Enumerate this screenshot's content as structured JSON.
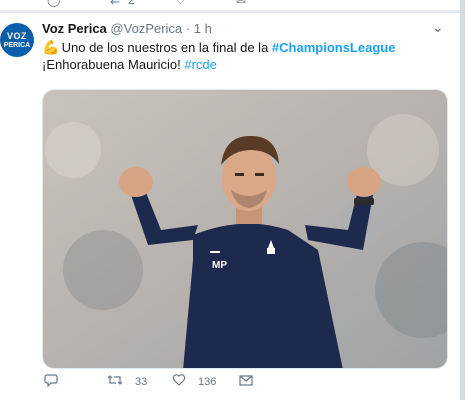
{
  "prev_tweet": {
    "retweet_count": "2"
  },
  "tweet": {
    "avatar_line1": "VOZ",
    "avatar_line2": "PERICA",
    "display_name": "Voz Perica",
    "handle": "@VozPerica",
    "separator": "·",
    "time": "1 h",
    "emoji": "💪",
    "text_part1": " Uno de los nuestros en la final de la ",
    "hashtag1": "#ChampionsLeague",
    "text_part2": " ¡Enhorabuena Mauricio! ",
    "hashtag2": "#rcde",
    "image_initials": "MP",
    "actions": {
      "reply_icon": "reply-icon",
      "retweet_icon": "retweet-icon",
      "retweet_count": "33",
      "like_icon": "heart-icon",
      "like_count": "136",
      "dm_icon": "envelope-icon"
    }
  },
  "colors": {
    "link": "#1da1f2",
    "text": "#14171a",
    "muted": "#657786",
    "brand_avatar": "#0b5ea8"
  }
}
